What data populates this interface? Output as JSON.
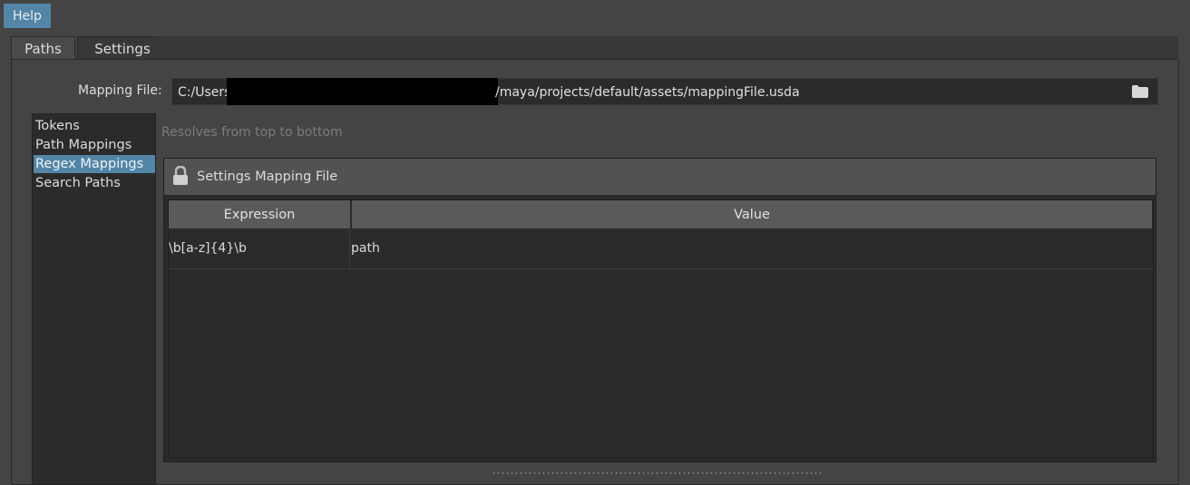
{
  "menu": {
    "help": "Help"
  },
  "tabs": [
    {
      "label": "Paths",
      "active": true
    },
    {
      "label": "Settings",
      "active": false
    }
  ],
  "mapping_file": {
    "label": "Mapping File:",
    "path_prefix": "C:/Users",
    "path_suffix": "/maya/projects/default/assets/mappingFile.usda",
    "browse_icon": "folder-icon"
  },
  "sidebar": {
    "items": [
      {
        "label": "Tokens",
        "selected": false
      },
      {
        "label": "Path Mappings",
        "selected": false
      },
      {
        "label": "Regex Mappings",
        "selected": true
      },
      {
        "label": "Search Paths",
        "selected": false
      }
    ]
  },
  "hint": "Resolves from top to bottom",
  "group": {
    "title": "Settings Mapping File",
    "icon": "lock-icon"
  },
  "table": {
    "columns": [
      "Expression",
      "Value"
    ],
    "rows": [
      {
        "expression": "\\b[a-z]{4}\\b",
        "value": "path"
      }
    ]
  },
  "colors": {
    "accent": "#5285a6",
    "background": "#444444",
    "field": "#2b2b2b"
  }
}
